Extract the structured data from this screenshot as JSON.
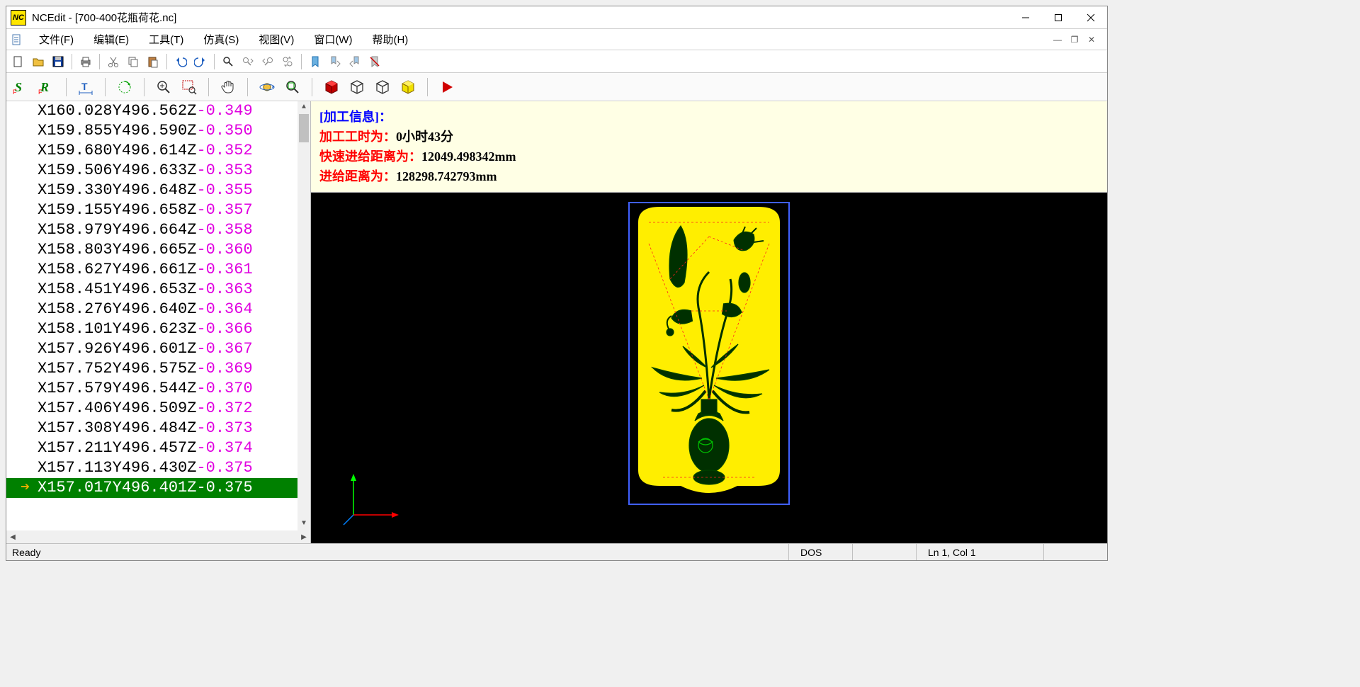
{
  "window": {
    "app_name": "NCEdit",
    "title": "NCEdit - [700-400花瓶荷花.nc]",
    "logo_text": "NC"
  },
  "menu": {
    "file": "文件(F)",
    "edit": "编辑(E)",
    "tool": "工具(T)",
    "sim": "仿真(S)",
    "view": "视图(V)",
    "window": "窗口(W)",
    "help": "帮助(H)"
  },
  "code_lines": [
    {
      "xy": "X160.028Y496.562Z",
      "z": "-0.349"
    },
    {
      "xy": "X159.855Y496.590Z",
      "z": "-0.350"
    },
    {
      "xy": "X159.680Y496.614Z",
      "z": "-0.352"
    },
    {
      "xy": "X159.506Y496.633Z",
      "z": "-0.353"
    },
    {
      "xy": "X159.330Y496.648Z",
      "z": "-0.355"
    },
    {
      "xy": "X159.155Y496.658Z",
      "z": "-0.357"
    },
    {
      "xy": "X158.979Y496.664Z",
      "z": "-0.358"
    },
    {
      "xy": "X158.803Y496.665Z",
      "z": "-0.360"
    },
    {
      "xy": "X158.627Y496.661Z",
      "z": "-0.361"
    },
    {
      "xy": "X158.451Y496.653Z",
      "z": "-0.363"
    },
    {
      "xy": "X158.276Y496.640Z",
      "z": "-0.364"
    },
    {
      "xy": "X158.101Y496.623Z",
      "z": "-0.366"
    },
    {
      "xy": "X157.926Y496.601Z",
      "z": "-0.367"
    },
    {
      "xy": "X157.752Y496.575Z",
      "z": "-0.369"
    },
    {
      "xy": "X157.579Y496.544Z",
      "z": "-0.370"
    },
    {
      "xy": "X157.406Y496.509Z",
      "z": "-0.372"
    },
    {
      "xy": "X157.308Y496.484Z",
      "z": "-0.373"
    },
    {
      "xy": "X157.211Y496.457Z",
      "z": "-0.374"
    },
    {
      "xy": "X157.113Y496.430Z",
      "z": "-0.375"
    },
    {
      "xy": "X157.017Y496.401Z",
      "z": "-0.375",
      "current": true
    }
  ],
  "info": {
    "header": "[加工信息]：",
    "time_label": "加工工时为：",
    "time_value": "0小时43分",
    "rapid_label": "快速进给距离为：",
    "rapid_value": "12049.498342mm",
    "feed_label": "进给距离为：",
    "feed_value": "128298.742793mm"
  },
  "status": {
    "ready": "Ready",
    "mode": "DOS",
    "position": "Ln 1, Col 1"
  }
}
